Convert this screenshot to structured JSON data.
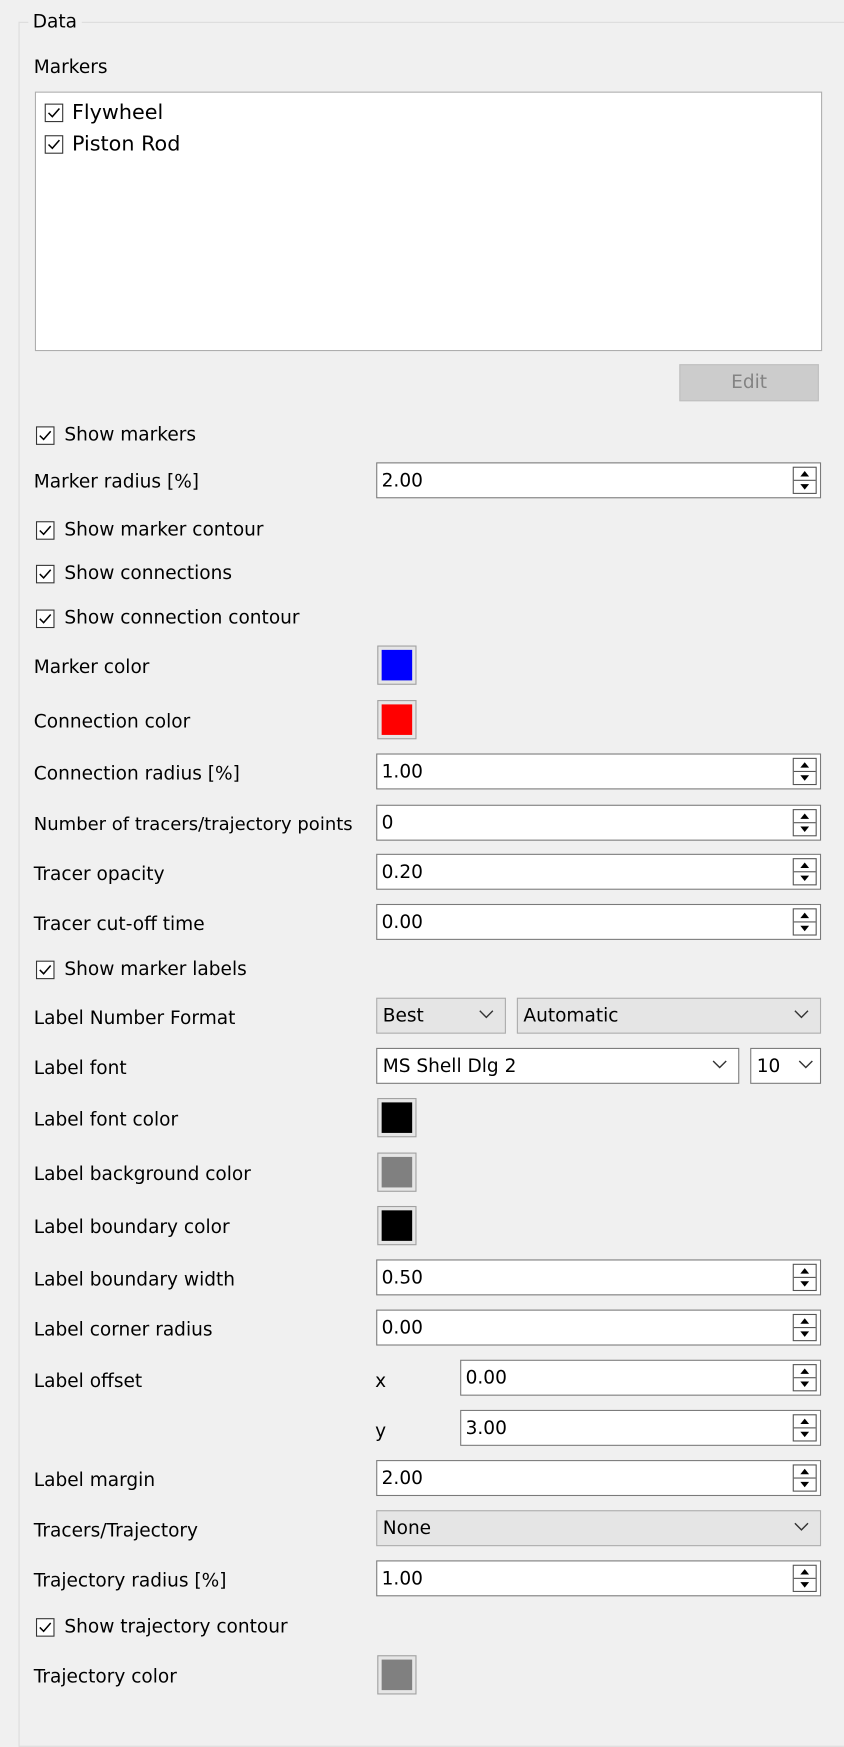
{
  "group": {
    "title": "Data"
  },
  "markers": {
    "label": "Markers",
    "items": [
      {
        "label": "Flywheel",
        "checked": true
      },
      {
        "label": "Piston Rod",
        "checked": true
      }
    ],
    "edit_button": "Edit"
  },
  "checks": {
    "show_markers": "Show markers",
    "show_marker_contour": "Show marker contour",
    "show_connections": "Show connections",
    "show_connection_contour": "Show connection contour",
    "show_marker_labels": "Show marker labels",
    "show_trajectory_contour": "Show trajectory contour"
  },
  "fields": {
    "marker_radius": {
      "label": "Marker radius [%]",
      "value": "2.00"
    },
    "marker_color": {
      "label": "Marker color",
      "color": "#0000ff"
    },
    "connection_color": {
      "label": "Connection color",
      "color": "#ff0000"
    },
    "connection_radius": {
      "label": "Connection radius [%]",
      "value": "1.00"
    },
    "num_tracers": {
      "label": "Number of tracers/trajectory points",
      "value": "0"
    },
    "tracer_opacity": {
      "label": "Tracer opacity",
      "value": "0.20"
    },
    "tracer_cutoff": {
      "label": "Tracer cut-off time",
      "value": "0.00"
    },
    "label_number_format": {
      "label": "Label Number Format",
      "value1": "Best",
      "value2": "Automatic"
    },
    "label_font": {
      "label": "Label font",
      "font": "MS Shell Dlg 2",
      "size": "10"
    },
    "label_font_color": {
      "label": "Label font color",
      "color": "#000000"
    },
    "label_bg_color": {
      "label": "Label background color",
      "color": "#808080"
    },
    "label_boundary_color": {
      "label": "Label boundary color",
      "color": "#000000"
    },
    "label_boundary_width": {
      "label": "Label boundary width",
      "value": "0.50"
    },
    "label_corner_radius": {
      "label": "Label corner radius",
      "value": "0.00"
    },
    "label_offset": {
      "label": "Label offset",
      "x_label": "x",
      "x": "0.00",
      "y_label": "y",
      "y": "3.00"
    },
    "label_margin": {
      "label": "Label margin",
      "value": "2.00"
    },
    "tracers_trajectory": {
      "label": "Tracers/Trajectory",
      "value": "None"
    },
    "trajectory_radius": {
      "label": "Trajectory radius [%]",
      "value": "1.00"
    },
    "trajectory_color": {
      "label": "Trajectory color",
      "color": "#808080"
    }
  }
}
